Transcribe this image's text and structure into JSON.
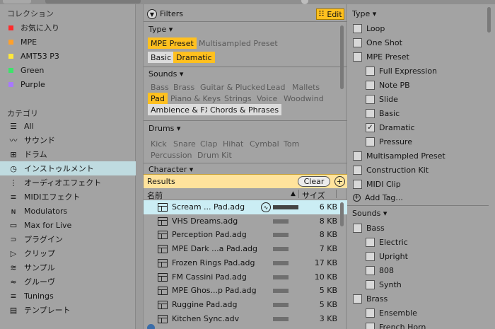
{
  "colors": {
    "accent": "#ffc01f",
    "selection": "#bfdbe0",
    "results_bar": "#ffe39c"
  },
  "left": {
    "collections_heading": "コレクション",
    "collections": [
      {
        "label": "お気に入り",
        "color": "#ff2a2a"
      },
      {
        "label": "MPE",
        "color": "#ffa02a"
      },
      {
        "label": "AMT53 P3",
        "color": "#ffe83a"
      },
      {
        "label": "Green",
        "color": "#3ce46a"
      },
      {
        "label": "Purple",
        "color": "#a878ff"
      }
    ],
    "categories_heading": "カテゴリ",
    "categories": [
      {
        "label": "All",
        "icon": "bars-icon"
      },
      {
        "label": "サウンド",
        "icon": "sound-icon"
      },
      {
        "label": "ドラム",
        "icon": "drum-grid-icon"
      },
      {
        "label": "インストゥルメント",
        "icon": "instrument-icon",
        "selected": true
      },
      {
        "label": "オーディオエフェクト",
        "icon": "audio-effect-icon"
      },
      {
        "label": "MIDIエフェクト",
        "icon": "midi-effect-icon"
      },
      {
        "label": "Modulators",
        "icon": "modulators-icon"
      },
      {
        "label": "Max for Live",
        "icon": "max-icon"
      },
      {
        "label": "プラグイン",
        "icon": "plugin-icon"
      },
      {
        "label": "クリップ",
        "icon": "clip-icon"
      },
      {
        "label": "サンプル",
        "icon": "sample-icon"
      },
      {
        "label": "グルーヴ",
        "icon": "groove-icon"
      },
      {
        "label": "Tunings",
        "icon": "tunings-icon"
      },
      {
        "label": "テンプレート",
        "icon": "template-icon"
      }
    ]
  },
  "filters": {
    "title": "Filters",
    "edit_label": "Edit",
    "type": {
      "title": "Type",
      "chips": [
        "MPE Preset",
        "Multisampled Preset",
        "Basic",
        "Dramatic"
      ]
    },
    "sounds": {
      "title": "Sounds",
      "chips": [
        "Bass",
        "Brass",
        "Guitar & Plucked",
        "Lead",
        "Mallets",
        "Pad",
        "Piano & Keys",
        "Strings",
        "Voice",
        "Woodwind",
        "Ambience & FX",
        "Chords & Phrases"
      ]
    },
    "drums": {
      "title": "Drums",
      "chips": [
        "Kick",
        "Snare",
        "Clap",
        "Hihat",
        "Cymbal",
        "Tom",
        "Percussion",
        "Drum Kit"
      ]
    },
    "character": {
      "title": "Character"
    }
  },
  "results": {
    "title": "Results",
    "clear_label": "Clear",
    "col_name": "名前",
    "col_size": "サイズ",
    "rows": [
      {
        "name": "Scream ... Pad.adg",
        "size": "6 KB",
        "selected": true,
        "bar": 1.0
      },
      {
        "name": "VHS Dreams.adg",
        "size": "8 KB",
        "bar": 0.6
      },
      {
        "name": "Perception Pad.adg",
        "size": "8 KB",
        "bar": 0.6
      },
      {
        "name": "MPE Dark ...a Pad.adg",
        "size": "7 KB",
        "bar": 0.6
      },
      {
        "name": "Frozen Rings Pad.adg",
        "size": "17 KB",
        "bar": 0.6
      },
      {
        "name": "FM Cassini Pad.adg",
        "size": "10 KB",
        "bar": 0.6
      },
      {
        "name": "MPE Ghos...p Pad.adg",
        "size": "5 KB",
        "bar": 0.6
      },
      {
        "name": "Ruggine Pad.adg",
        "size": "5 KB",
        "bar": 0.6
      },
      {
        "name": "Kitchen Sync.adv",
        "size": "3 KB",
        "bar": 0.6
      }
    ]
  },
  "right": {
    "type_heading": "Type",
    "type_items": [
      {
        "label": "Loop",
        "level": 0,
        "checked": false
      },
      {
        "label": "One Shot",
        "level": 0,
        "checked": false
      },
      {
        "label": "MPE Preset",
        "level": 0,
        "checked": false
      },
      {
        "label": "Full Expression",
        "level": 1,
        "checked": false
      },
      {
        "label": "Note PB",
        "level": 1,
        "checked": false
      },
      {
        "label": "Slide",
        "level": 1,
        "checked": false
      },
      {
        "label": "Basic",
        "level": 1,
        "checked": false
      },
      {
        "label": "Dramatic",
        "level": 1,
        "checked": true
      },
      {
        "label": "Pressure",
        "level": 1,
        "checked": false
      },
      {
        "label": "Multisampled Preset",
        "level": 0,
        "checked": false
      },
      {
        "label": "Construction Kit",
        "level": 0,
        "checked": false
      },
      {
        "label": "MIDI Clip",
        "level": 0,
        "checked": false
      }
    ],
    "add_tag_label": "Add Tag...",
    "sounds_heading": "Sounds",
    "sounds_items": [
      {
        "label": "Bass",
        "level": 0,
        "checked": false
      },
      {
        "label": "Electric",
        "level": 1,
        "checked": false
      },
      {
        "label": "Upright",
        "level": 1,
        "checked": false
      },
      {
        "label": "808",
        "level": 1,
        "checked": false
      },
      {
        "label": "Synth",
        "level": 1,
        "checked": false
      },
      {
        "label": "Brass",
        "level": 0,
        "checked": false
      },
      {
        "label": "Ensemble",
        "level": 1,
        "checked": false
      },
      {
        "label": "French Horn",
        "level": 1,
        "checked": false
      }
    ]
  }
}
